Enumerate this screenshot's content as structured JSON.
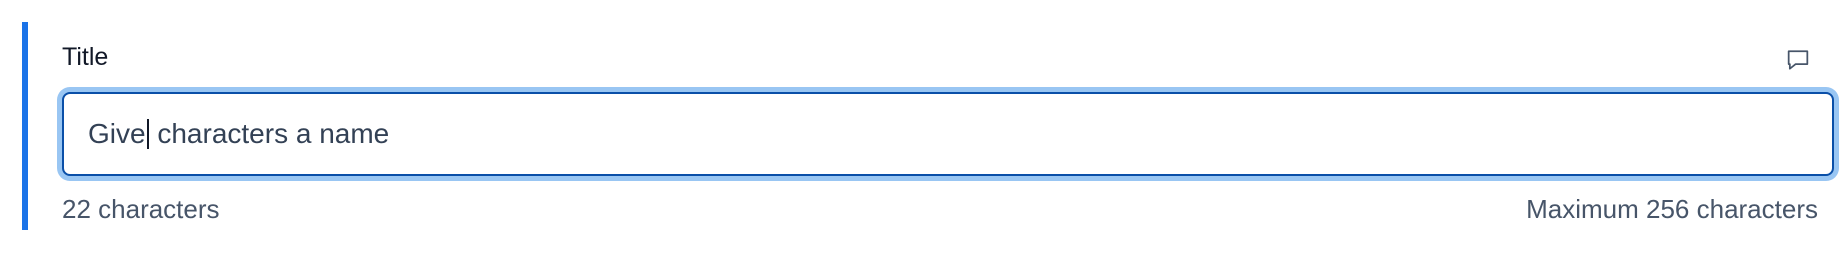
{
  "field": {
    "label": "Title",
    "value_before_caret": "Give",
    "value_after_caret": " characters a name",
    "char_count_text": "22 characters",
    "max_text": "Maximum 256 characters",
    "comment_icon": "comment-icon"
  },
  "colors": {
    "accent_bar": "#1a73e8",
    "focus_border": "#0a4fa8",
    "focus_ring": "#99c6f3",
    "text": "#334155"
  }
}
